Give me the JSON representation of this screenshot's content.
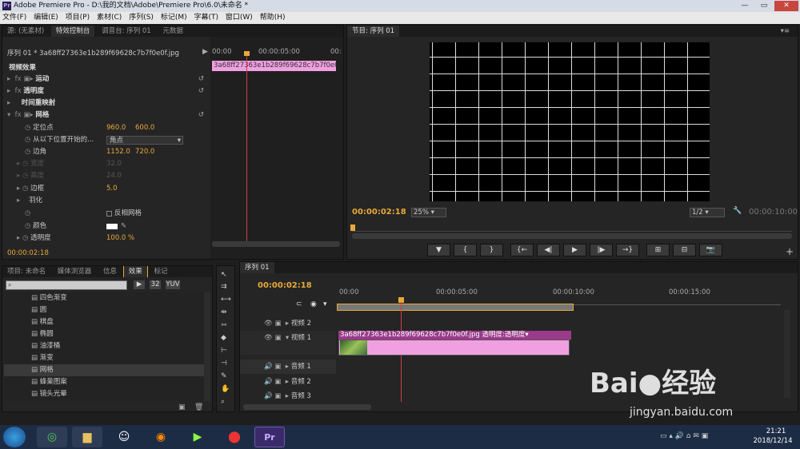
{
  "window": {
    "title": "Adobe Premiere Pro - D:\\我的文档\\Adobe\\Premiere Pro\\6.0\\未命名 *",
    "app_icon": "Pr",
    "minimize": "—",
    "maximize": "▭",
    "close": "✕"
  },
  "menu": [
    "文件(F)",
    "编辑(E)",
    "项目(P)",
    "素材(C)",
    "序列(S)",
    "标记(M)",
    "字幕(T)",
    "窗口(W)",
    "帮助(H)"
  ],
  "effect_controls": {
    "tabs": [
      "源: (无素材)",
      "特效控制台",
      "调音台: 序列 01",
      "元数据"
    ],
    "clip_label": "序列 01 * 3a68ff27363e1b289f69628c7b7f0e0f.jpg",
    "mini_clip": "3a68ff27363e1b289f69628c7b7f0e0f.jpg",
    "section": "视频效果",
    "ruler": [
      "00:00",
      "00:00:05:00",
      "00:"
    ],
    "rows": [
      {
        "label": "运动",
        "type": "fx"
      },
      {
        "label": "透明度",
        "type": "fx"
      },
      {
        "label": "时间重映射",
        "type": "plain"
      },
      {
        "label": "网格",
        "type": "fx"
      }
    ],
    "params": [
      {
        "label": "定位点",
        "v1": "960.0",
        "v2": "600.0"
      },
      {
        "label": "从以下位置开始的...",
        "dropdown": "角点"
      },
      {
        "label": "边角",
        "v1": "1152.0",
        "v2": "720.0"
      },
      {
        "label": "宽度",
        "v1": "32.0",
        "dim": true
      },
      {
        "label": "高度",
        "v1": "24.0",
        "dim": true
      },
      {
        "label": "边框",
        "v1": "5.0"
      },
      {
        "label": "羽化"
      },
      {
        "label": "反相网格",
        "checkbox": true
      },
      {
        "label": "颜色"
      },
      {
        "label": "透明度",
        "v1": "100.0 %"
      }
    ],
    "timecode": "00:00:02:18"
  },
  "program": {
    "tab": "节目: 序列 01",
    "timecode": "00:00:02:18",
    "zoom": "25%",
    "quality": "1/2",
    "duration": "00:00:10:00",
    "controls": [
      "▼",
      "{",
      "}",
      "{←",
      "◀|",
      "▶",
      "|▶",
      "→}",
      "⊞",
      "⊟",
      "📷"
    ]
  },
  "project": {
    "tabs": [
      "项目: 未命名",
      "媒体浏览器",
      "信息",
      "效果",
      "标记"
    ],
    "items": [
      "四色渐变",
      "圆",
      "棋盘",
      "椭圆",
      "油漆桶",
      "渐变",
      "网格",
      "蜂巢图案",
      "镜头光晕"
    ],
    "selected": "网格",
    "badges": [
      "32",
      "YUV"
    ]
  },
  "timeline": {
    "tab": "序列 01",
    "timecode": "00:00:02:18",
    "ruler": [
      "00:00",
      "00:00:05:00",
      "00:00:10:00",
      "00:00:15:00"
    ],
    "tracks": [
      {
        "name": "视频 2"
      },
      {
        "name": "视频 1"
      },
      {
        "name": "音频 1"
      },
      {
        "name": "音频 2"
      },
      {
        "name": "音频 3"
      }
    ],
    "clip_label": "3a68ff27363e1b289f69628c7b7f0e0f.jpg  透明度:透明度▾"
  },
  "watermark": {
    "brand": "Bai",
    "brand2": "经验",
    "url": "jingyan.baidu.com"
  },
  "taskbar": {
    "time": "21:21",
    "date": "2018/12/14"
  },
  "colors": {
    "accent": "#e8a93a",
    "clip": "#f0a0e0",
    "clip_header": "#9a3a8a"
  }
}
